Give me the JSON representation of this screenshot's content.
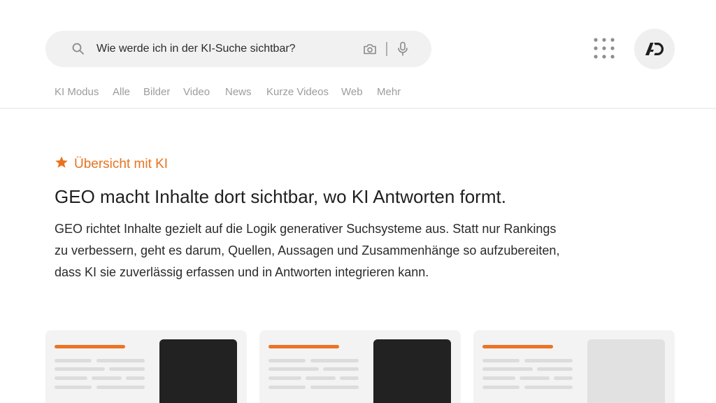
{
  "search": {
    "query": "Wie werde ich in der KI-Suche sichtbar?",
    "icons": [
      "search-icon",
      "camera-icon",
      "mic-icon"
    ]
  },
  "header": {
    "apps_icon": "apps-grid-icon",
    "avatar_icon": "ad-logo-icon"
  },
  "tabs": [
    "KI Modus",
    "Alle",
    "Bilder",
    "Video",
    "News",
    "Kurze Videos",
    "Web",
    "Mehr"
  ],
  "overview": {
    "label": "Übersicht mit KI",
    "headline": "GEO macht Inhalte dort sichtbar, wo KI Antworten formt.",
    "paragraph_lines": [
      "GEO richtet Inhalte gezielt auf die Logik generativer Suchsysteme aus. Statt nur Rankings",
      "zu verbessern, geht es darum, Quellen, Aussagen und Zusammenhänge so aufzubereiten,",
      "dass KI sie zuverlässig erfassen und in Antworten integrieren kann."
    ]
  },
  "cards": [
    {
      "thumb": "dark"
    },
    {
      "thumb": "dark"
    },
    {
      "thumb": "light"
    }
  ],
  "colors": {
    "accent": "#e8731f",
    "searchbar_bg": "#f1f1f1",
    "card_bg": "#f3f3f3",
    "tab_text": "#9c9c9c"
  }
}
